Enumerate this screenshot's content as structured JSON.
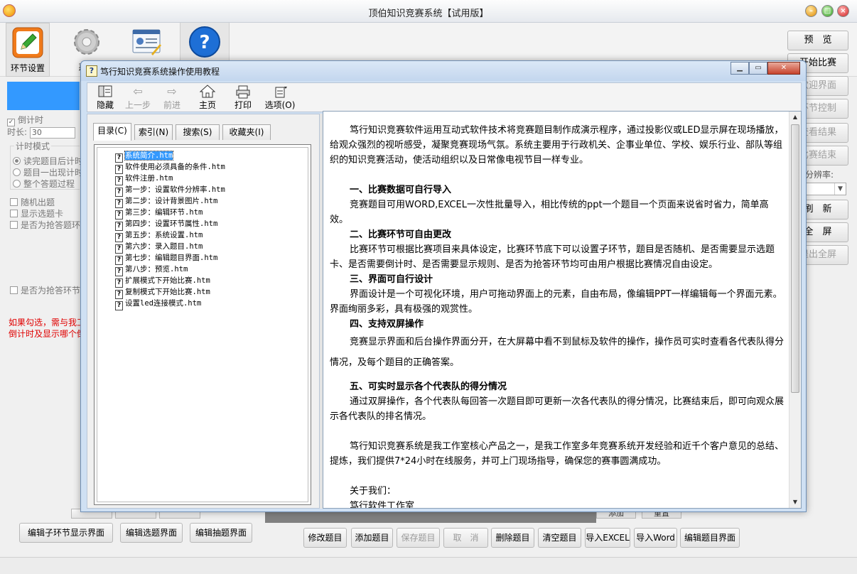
{
  "app": {
    "title": "顶伯知识竞赛系统【试用版】",
    "toolbar": [
      {
        "label": "环节设置"
      },
      {
        "label": "系统"
      },
      {
        "label": ""
      },
      {
        "label": ""
      }
    ],
    "left_panel": {
      "countdown": "倒计时",
      "duration_label": "时长:",
      "duration_value": "30",
      "timer_mode": "计时模式",
      "radio1": "读完题目后计时",
      "radio2": "题目一出现计时",
      "radio3": "整个答题过程",
      "random": "随机出题",
      "show_cards": "显示选题卡",
      "is_quick_answer": "是否为抢答题环节",
      "is_quick_answer2": "是否为抢答环节",
      "note_line1": "如果勾选，需与我工",
      "note_line2": "倒计时及显示哪个倒"
    },
    "right_buttons": [
      "预　览",
      "开始比赛",
      "欢迎界面",
      "环节控制",
      "查看结果",
      "比赛结束",
      "刷　新",
      "全　屏",
      "退出全屏"
    ],
    "resolution_label": "分辨率:",
    "bottom_left_buttons": [
      "编辑子环节显示界面",
      "编辑选题界面",
      "编辑抽题界面"
    ],
    "bottom_buttons": [
      "修改题目",
      "添加题目",
      "保存题目",
      "取　消",
      "删除题目",
      "清空题目",
      "导入EXCEL",
      "导入Word",
      "编辑题目界面"
    ],
    "behind_buttons": [
      "添加",
      "重置"
    ]
  },
  "help": {
    "title": "笃行知识竞赛系统操作使用教程",
    "toolbar": [
      {
        "label": "隐藏",
        "icon": "hide-icon",
        "enabled": true
      },
      {
        "label": "上一步",
        "icon": "back-arrow-icon",
        "enabled": false
      },
      {
        "label": "前进",
        "icon": "forward-arrow-icon",
        "enabled": false
      },
      {
        "label": "主页",
        "icon": "home-icon",
        "enabled": true
      },
      {
        "label": "打印",
        "icon": "print-icon",
        "enabled": true
      },
      {
        "label": "选项(O)",
        "icon": "options-icon",
        "enabled": true
      }
    ],
    "tabs": [
      "目录(C)",
      "索引(N)",
      "搜索(S)",
      "收藏夹(I)"
    ],
    "tree": [
      "系统简介.htm",
      "软件使用必须具备的条件.htm",
      "软件注册.htm",
      "第一步：设置软件分辨率.htm",
      "第二步：设计背景图片.htm",
      "第三步：编辑环节.htm",
      "第四步：设置环节属性.htm",
      "第五步：系统设置.htm",
      "第六步：录入题目.htm",
      "第七步：编辑题目界面.htm",
      "第八步：预览.htm",
      "扩展模式下开始比赛.htm",
      "复制模式下开始比赛.htm",
      "设置led连接模式.htm"
    ],
    "selected_index": 0,
    "content": {
      "intro": "笃行知识竞赛软件运用互动式软件技术将竞赛题目制作成演示程序，通过投影仪或LED显示屏在现场播放，给观众强烈的视听感受，凝聚竞赛现场气氛。系统主要用于行政机关、企事业单位、学校、娱乐行业、部队等组织的知识竞赛活动，使活动组织以及日常像电视节目一样专业。",
      "h1": "一、比赛数据可自行导入",
      "p1": "竞赛题目可用WORD,EXCEL一次性批量导入，相比传统的ppt一个题目一个页面来说省时省力，简单高效。",
      "h2": "二、比赛环节可自由更改",
      "p2": "比赛环节可根据比赛项目来具体设定，比赛环节底下可以设置子环节，题目是否随机、是否需要显示选题卡、是否需要倒计时、是否需要显示规则、是否为抢答环节均可由用户根据比赛情况自由设定。",
      "h3": "三、界面可自行设计",
      "p3": "界面设计是一个可视化环境，用户可拖动界面上的元素，自由布局，像编辑PPT一样编辑每一个界面元素。界面绚丽多彩，具有极强的观赏性。",
      "h4": "四、支持双屏操作",
      "p4": "竞赛显示界面和后台操作界面分开，在大屏幕中看不到鼠标及软件的操作，操作员可实时查看各代表队得分情况，及每个题目的正确答案。",
      "h5": "五、可实时显示各个代表队的得分情况",
      "p5": "通过双屏操作，各个代表队每回答一次题目即可更新一次各代表队的得分情况，比赛结束后，即可向观众展示各代表队的排名情况。",
      "p6": "笃行知识竞赛系统是我工作室核心产品之一，是我工作室多年竞赛系统开发经验和近千个客户意见的总结、提炼，我们提供7*24小时在线服务，并可上门现场指导，确保您的赛事圆满成功。",
      "about": "关于我们：",
      "studio": "笃行软件工作室"
    }
  }
}
